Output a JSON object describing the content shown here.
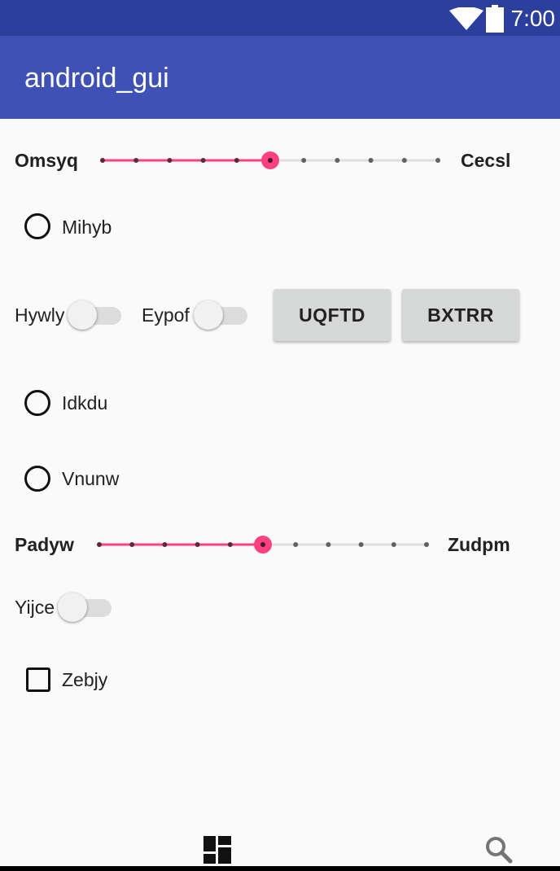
{
  "status_bar": {
    "time": "7:00",
    "wifi_icon": "wifi-icon",
    "battery_icon": "battery-icon"
  },
  "app_bar": {
    "title": "android_gui"
  },
  "slider1": {
    "label_left": "Omsyq",
    "label_right": "Cecsl",
    "steps": 10,
    "value": 5
  },
  "radio1": {
    "label": "Mihyb",
    "checked": false
  },
  "switch1": {
    "label": "Hywly",
    "on": false
  },
  "switch2": {
    "label": "Eypof",
    "on": false
  },
  "button1": {
    "label": "UQFTD"
  },
  "button2": {
    "label": "BXTRR"
  },
  "radio2": {
    "label": "Idkdu",
    "checked": false
  },
  "radio3": {
    "label": "Vnunw",
    "checked": false
  },
  "slider2": {
    "label_left": "Padyw",
    "label_right": "Zudpm",
    "steps": 10,
    "value": 5
  },
  "switch3": {
    "label": "Yijce",
    "on": false
  },
  "checkbox1": {
    "label": "Zebjy",
    "checked": false
  },
  "bottom_nav": {
    "left_icon": "dashboard-icon",
    "right_icon": "search-icon"
  },
  "colors": {
    "accent": "#ff4081",
    "primary": "#3f51b5",
    "primary_dark": "#2d3f9c"
  }
}
